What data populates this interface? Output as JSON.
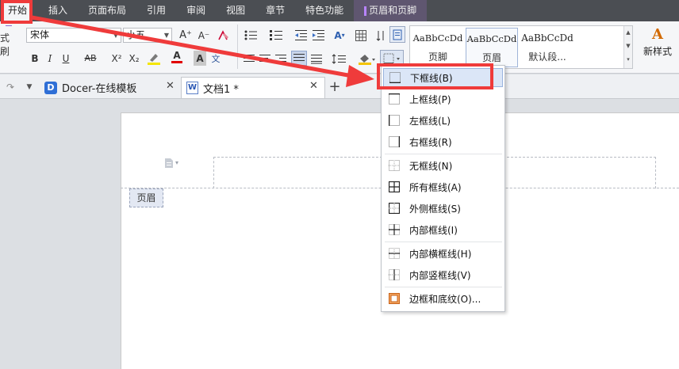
{
  "menubar": {
    "items": [
      "开始",
      "插入",
      "页面布局",
      "引用",
      "审阅",
      "视图",
      "章节",
      "特色功能",
      "页眉和页脚"
    ]
  },
  "ribbon": {
    "format_painter_label": "式刷",
    "font_name": "宋体",
    "font_size": "小五",
    "bold": "B",
    "italic": "I",
    "underline": "U",
    "strike": "AB",
    "superscript": "X²",
    "subscript": "X₂",
    "font_color_glyph": "A",
    "pinyin_glyph": "文",
    "grow_font": "A⁺",
    "shrink_font": "A⁻",
    "char_shading_glyph": "A",
    "styles": [
      {
        "sample": "AaBbCcDd",
        "name": "页脚"
      },
      {
        "sample": "AaBbCcDd",
        "name": "页眉"
      },
      {
        "sample": "AaBbCcDd",
        "name": "默认段..."
      }
    ],
    "new_style_label": "新样式",
    "new_style_glyph": "A"
  },
  "tabs": [
    {
      "label": "Docer-在线模板",
      "icon": "D"
    },
    {
      "label": "文档1 *",
      "icon": "W"
    }
  ],
  "add_tab": "+",
  "document": {
    "header_tag": "页眉"
  },
  "dropdown": {
    "items": [
      {
        "label": "下框线(B)",
        "icon": "bottom-border-icon"
      },
      {
        "label": "上框线(P)",
        "icon": "top-border-icon"
      },
      {
        "label": "左框线(L)",
        "icon": "left-border-icon"
      },
      {
        "label": "右框线(R)",
        "icon": "right-border-icon"
      },
      {
        "label": "无框线(N)",
        "icon": "no-border-icon"
      },
      {
        "label": "所有框线(A)",
        "icon": "all-borders-icon"
      },
      {
        "label": "外侧框线(S)",
        "icon": "outside-borders-icon"
      },
      {
        "label": "内部框线(I)",
        "icon": "inside-borders-icon"
      },
      {
        "label": "内部横框线(H)",
        "icon": "inside-horizontal-border-icon"
      },
      {
        "label": "内部竖框线(V)",
        "icon": "inside-vertical-border-icon"
      },
      {
        "label": "边框和底纹(O)...",
        "icon": "borders-and-shading-icon"
      }
    ]
  },
  "colors": {
    "annotation_red": "#ef3b3b",
    "menubar_bg": "#4b4e53",
    "highlight_blue": "#dbe6f7"
  }
}
